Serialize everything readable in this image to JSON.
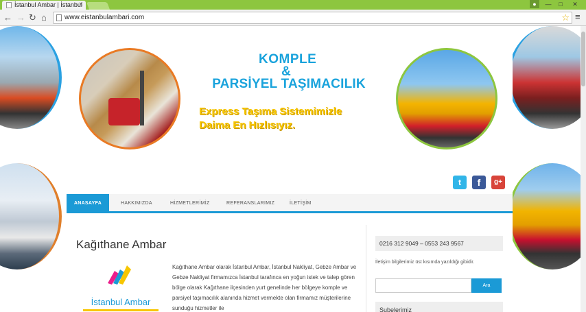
{
  "browser": {
    "tab_title": "İstanbul Ambar | İstanbul",
    "tab_close": "×",
    "url": "www.eistanbulambari.com",
    "back_glyph": "←",
    "forward_glyph": "→",
    "reload_glyph": "↻",
    "home_glyph": "⌂",
    "star_glyph": "☆",
    "menu_glyph": "≡",
    "minimize_glyph": "—",
    "maximize_glyph": "□",
    "close_glyph": "✕"
  },
  "banner": {
    "title_line1": "KOMPLE",
    "title_amp": "&",
    "title_line2": "PARSİYEL TAŞIMACILIK",
    "slogan_line1": "Express Taşıma Sistemimizle",
    "slogan_line2": "Daima En Hızlısıyız."
  },
  "social": {
    "twitter_glyph": "t",
    "facebook_glyph": "f",
    "google_glyph": "g+"
  },
  "menu": {
    "items": [
      {
        "label": "ANASAYFA"
      },
      {
        "label": "HAKKIMIZDA"
      },
      {
        "label": "HİZMETLERİMİZ"
      },
      {
        "label": "REFERANSLARIMIZ"
      },
      {
        "label": "İLETİŞİM"
      }
    ]
  },
  "content": {
    "title": "Kağıthane Ambar",
    "logo_text": "İstanbul Ambar",
    "body": "Kağıthane Ambar olarak İstanbul Ambar, İstanbul Nakliyat, Gebze Ambar ve Gebze Nakliyat firmamızca İstanbul tarafınca en yoğun istek ve talep gören bölge olarak Kağıthane ilçesinden yurt genelinde her bölgeye komple ve parsiyel taşımacılık alanında hizmet vermekte olan firmamız müşterilerine sunduğu hizmetler ile"
  },
  "sidebar": {
    "phone": "0216 312 9049 – 0553 243 9567",
    "info": "İletişim bilgilerimiz üst kısımda yazıldığı gibidir.",
    "search_button": "Ara",
    "branches_title": "Şubelerimiz"
  },
  "colors": {
    "accent": "#1b9ad6",
    "chrome": "#8dc63f",
    "slogan": "#f7c600"
  }
}
